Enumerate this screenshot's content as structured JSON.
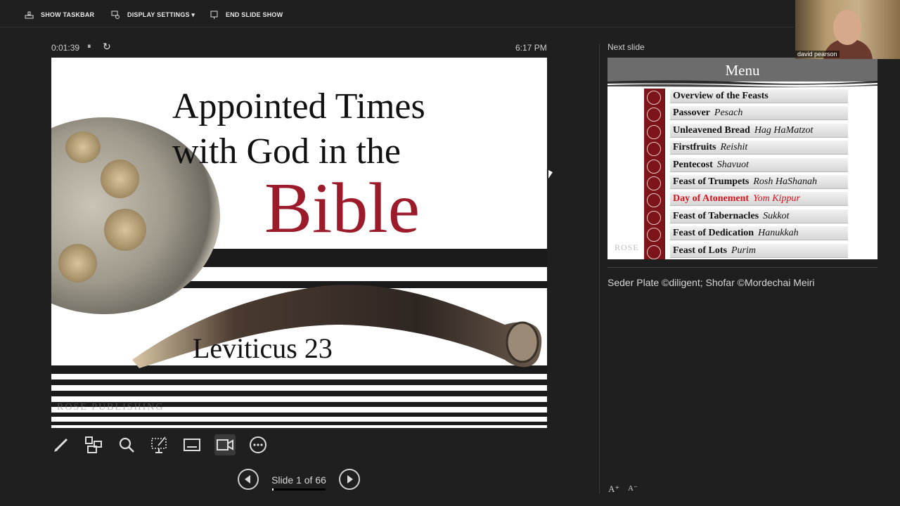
{
  "toolbar": {
    "show_taskbar": "SHOW TASKBAR",
    "display_settings": "DISPLAY SETTINGS ▾",
    "end_slide_show": "END SLIDE SHOW"
  },
  "timer": {
    "elapsed": "0:01:39",
    "pause_icon": "⏸",
    "restart_icon": "↻"
  },
  "clock": "6:17 PM",
  "current_slide": {
    "title_line1": "Appointed Times",
    "title_line2": "with God in the",
    "title_emphasis": "Bible",
    "reference": "Leviticus 23",
    "watermark": "ROSE PUBLISHING",
    "accent_color": "#9b1b2a"
  },
  "tools": [
    "pen-icon",
    "see-all-slides-icon",
    "zoom-icon",
    "pointer-options-icon",
    "subtitles-icon",
    "camera-icon",
    "more-options-icon"
  ],
  "navigation": {
    "label": "Slide 1 of 66",
    "current": 1,
    "total": 66
  },
  "next_slide": {
    "heading": "Next slide",
    "menu_title": "Menu",
    "watermark": "ROSE",
    "items": [
      {
        "name": "Overview of the Feasts",
        "hebrew": ""
      },
      {
        "name": "Passover",
        "hebrew": "Pesach"
      },
      {
        "name": "Unleavened Bread",
        "hebrew": "Hag HaMatzot"
      },
      {
        "name": "Firstfruits",
        "hebrew": "Reishit"
      },
      {
        "name": "Pentecost",
        "hebrew": "Shavuot"
      },
      {
        "name": "Feast of Trumpets",
        "hebrew": "Rosh HaShanah"
      },
      {
        "name": "Day of Atonement",
        "hebrew": "Yom Kippur"
      },
      {
        "name": "Feast of Tabernacles",
        "hebrew": "Sukkot"
      },
      {
        "name": "Feast of Dedication",
        "hebrew": "Hanukkah"
      },
      {
        "name": "Feast of Lots",
        "hebrew": "Purim"
      }
    ],
    "highlight_color": "#d5141e"
  },
  "notes": "Seder Plate ©diligent; Shofar ©Mordechai Meiri",
  "font_controls": {
    "increase": "A⁺",
    "decrease": "A⁻"
  },
  "webcam": {
    "name": "david pearson"
  }
}
